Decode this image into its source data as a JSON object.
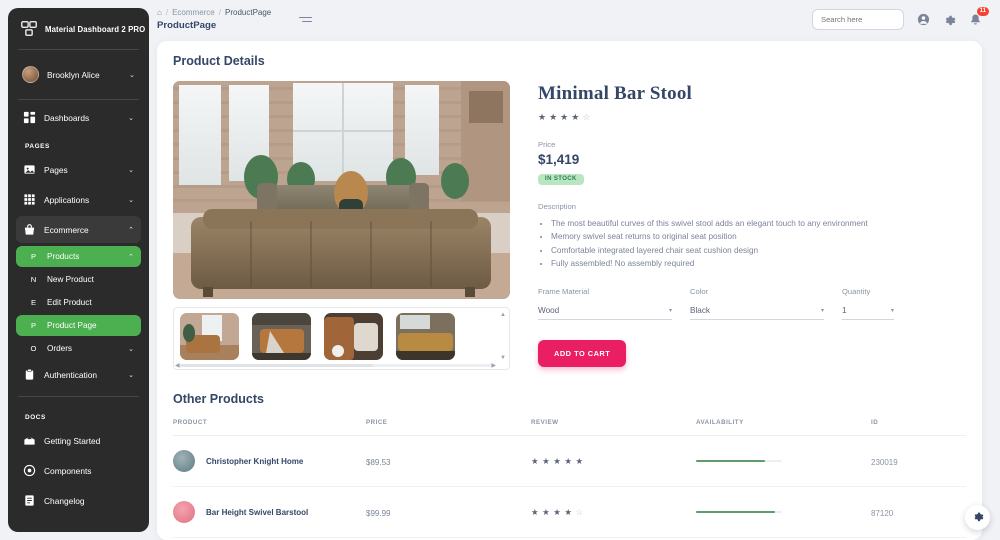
{
  "brand": {
    "name": "Material Dashboard 2 PRO",
    "logo_icon": "dashboard-logo-icon"
  },
  "sidebar": {
    "user": {
      "name": "Brooklyn Alice",
      "avatar_icon": "avatar",
      "chevron": "⌄"
    },
    "items": [
      {
        "label": "Dashboards",
        "icon": "dashboards-icon",
        "chevron": "⌄"
      }
    ],
    "pages_section": "PAGES",
    "page_items": [
      {
        "label": "Pages",
        "icon": "pages-icon",
        "chevron": "⌄"
      },
      {
        "label": "Applications",
        "icon": "applications-icon",
        "chevron": "⌄"
      },
      {
        "label": "Ecommerce",
        "icon": "ecommerce-icon",
        "chevron": "⌃"
      }
    ],
    "products": {
      "label": "Products",
      "mini": "P",
      "chevron": "⌃"
    },
    "product_subitems": [
      {
        "label": "New Product",
        "mini": "N"
      },
      {
        "label": "Edit Product",
        "mini": "E"
      },
      {
        "label": "Product Page",
        "mini": "P"
      }
    ],
    "orders": {
      "label": "Orders",
      "mini": "O",
      "chevron": "⌄"
    },
    "authentication": {
      "label": "Authentication",
      "icon": "authentication-icon",
      "chevron": "⌄"
    },
    "docs_section": "DOCS",
    "docs_items": [
      {
        "label": "Getting Started",
        "icon": "getting-started-icon"
      },
      {
        "label": "Components",
        "icon": "components-icon"
      },
      {
        "label": "Changelog",
        "icon": "changelog-icon"
      }
    ]
  },
  "topbar": {
    "breadcrumb": {
      "home_icon": "home-icon",
      "parent": "Ecommerce",
      "current": "ProductPage",
      "separator": "/"
    },
    "page_title": "ProductPage",
    "menu_toggle_icon": "hamburger-icon",
    "search_placeholder": "Search here",
    "account_icon": "account-circle-icon",
    "settings_icon": "gear-icon",
    "notifications_icon": "bell-icon",
    "notifications_count": "11"
  },
  "product": {
    "card_title": "Product Details",
    "name": "Minimal Bar Stool",
    "rating": 4,
    "rating_max": 5,
    "price_label": "Price",
    "price": "$1,419",
    "stock_badge": "IN STOCK",
    "description_label": "Description",
    "description_items": [
      "The most beautiful curves of this swivel stool adds an elegant touch to any environment",
      "Memory swivel seat returns to original seat position",
      "Comfortable integrated layered chair seat cushion design",
      "Fully assembled! No assembly required"
    ],
    "options": [
      {
        "label": "Frame Material",
        "value": "Wood",
        "chevron": "▾"
      },
      {
        "label": "Color",
        "value": "Black",
        "chevron": "▾"
      },
      {
        "label": "Quantity",
        "value": "1",
        "chevron": "▾"
      }
    ],
    "add_to_cart": "ADD TO CART",
    "gallery": {
      "main_image_alt": "living-room-leather-sofa",
      "thumbnails": [
        "thumb-armchair",
        "thumb-sofa-throw",
        "thumb-coffee-cushion",
        "thumb-tufted-sofa"
      ],
      "scroll_left": "◀",
      "scroll_right": "▶",
      "scroll_up": "▲",
      "scroll_down": "▼"
    }
  },
  "other_products": {
    "title": "Other Products",
    "columns": [
      "PRODUCT",
      "PRICE",
      "REVIEW",
      "AVAILABILITY",
      "ID"
    ],
    "rows": [
      {
        "name": "Christopher Knight Home",
        "price": "$89.53",
        "rating": 5,
        "availability": 80,
        "id": "230019",
        "avatar": "avatar-teal"
      },
      {
        "name": "Bar Height Swivel Barstool",
        "price": "$99.99",
        "rating": 4,
        "availability": 92,
        "id": "87120",
        "avatar": "avatar-pink"
      }
    ]
  },
  "fab": {
    "icon": "gear-icon"
  },
  "colors": {
    "accent_green": "#4caf50",
    "accent_pink": "#e91e63",
    "badge_red": "#f44335",
    "progress_green": "#5f9c6a",
    "text": "#344767"
  }
}
